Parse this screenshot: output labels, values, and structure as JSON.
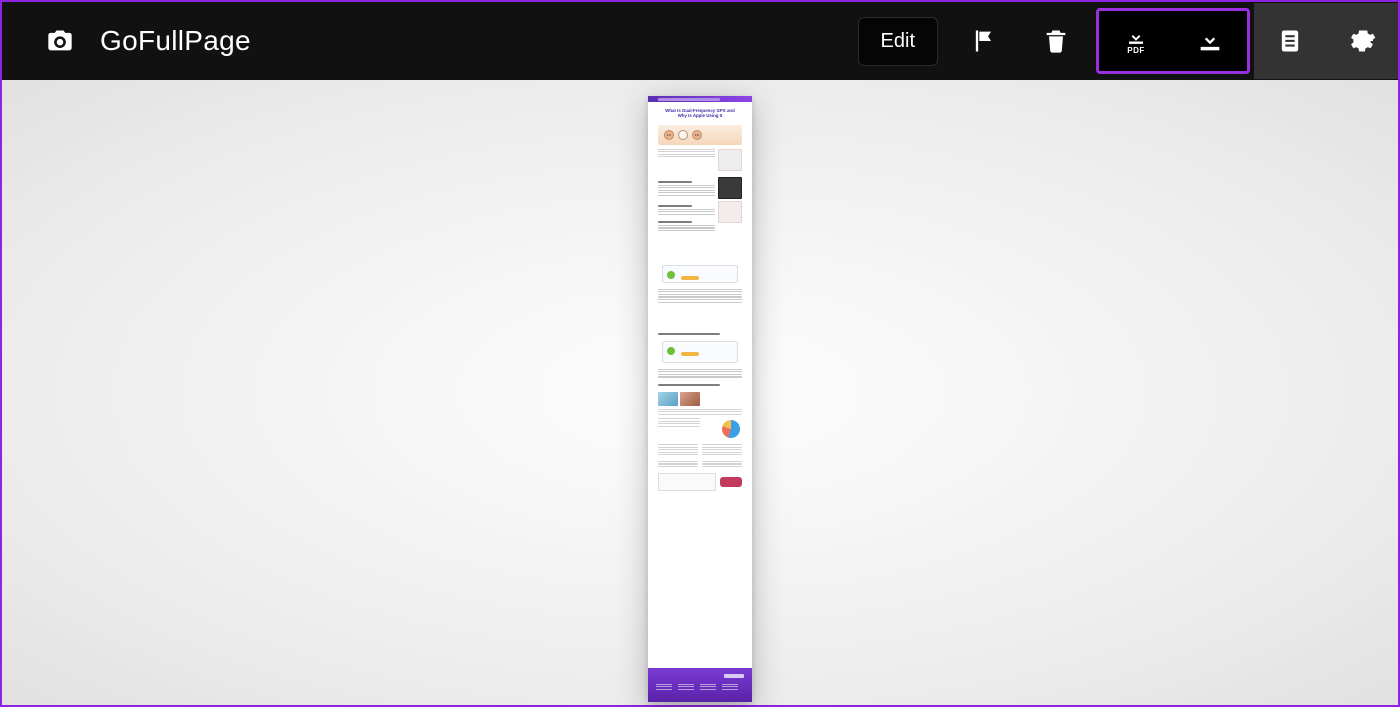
{
  "app": {
    "title": "GoFullPage"
  },
  "toolbar": {
    "edit_label": "Edit",
    "icons": {
      "camera": "camera-icon",
      "flag": "flag-icon",
      "trash": "trash-icon",
      "download_pdf": "download-pdf-icon",
      "download_image": "download-image-icon",
      "files": "files-icon",
      "settings": "settings-icon"
    },
    "pdf_badge": "PDF"
  },
  "preview": {
    "article_title": "What Is Dual-Frequency GPS and Why Is Apple Using It",
    "hero_labels": [
      "L1",
      "",
      "L5"
    ]
  },
  "colors": {
    "accent": "#8e24e2",
    "toolbar_bg": "#111111",
    "settings_bg": "#333333"
  }
}
